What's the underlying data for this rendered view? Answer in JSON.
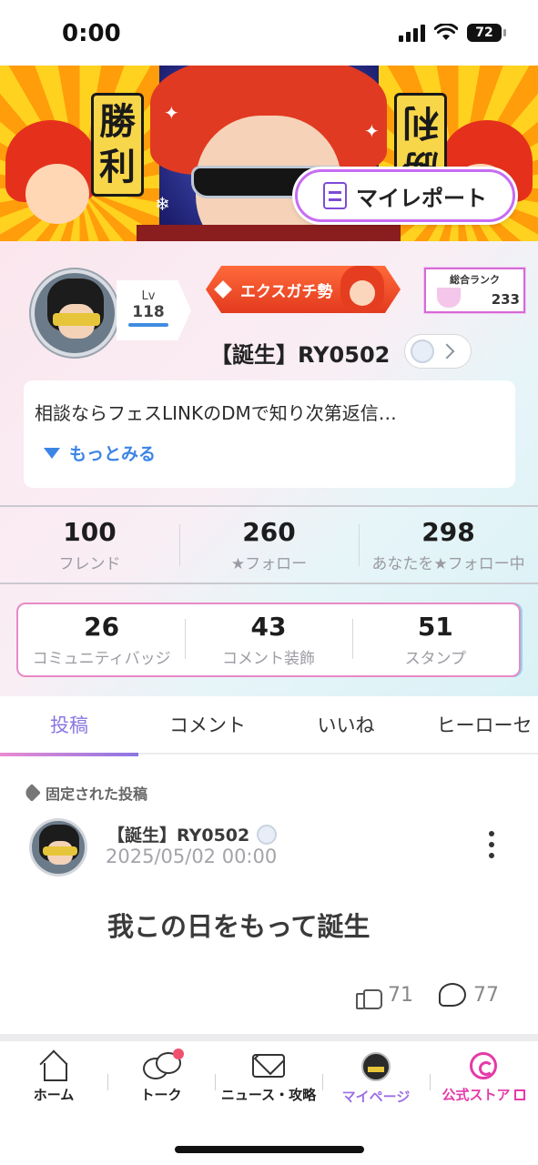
{
  "status_bar": {
    "time": "0:00",
    "battery": "72"
  },
  "banner": {
    "kanji_left": "勝利",
    "kanji_right": "勝利",
    "my_report_label": "マイレポート"
  },
  "profile": {
    "level_label": "Lv",
    "level_value": "118",
    "title_badge": "エクスガチ勢",
    "rank_label": "総合ランク",
    "rank_value": "233",
    "username": "【誕生】RY0502",
    "bio": "相談ならフェスLINKのDMで知り次第返信…",
    "see_more": "もっとみる"
  },
  "stats": [
    {
      "value": "100",
      "label": "フレンド"
    },
    {
      "value": "260",
      "label": "★フォロー"
    },
    {
      "value": "298",
      "label": "あなたを★フォロー中"
    }
  ],
  "collections": [
    {
      "value": "26",
      "label": "コミュニティバッジ"
    },
    {
      "value": "43",
      "label": "コメント装飾"
    },
    {
      "value": "51",
      "label": "スタンプ"
    }
  ],
  "tabs": [
    {
      "label": "投稿",
      "active": true
    },
    {
      "label": "コメント",
      "active": false
    },
    {
      "label": "いいね",
      "active": false
    },
    {
      "label": "ヒーローセ",
      "active": false
    }
  ],
  "post": {
    "pinned_label": "固定された投稿",
    "author": "【誕生】RY0502",
    "date": "2025/05/02 00:00",
    "body": "我この日をもって誕生",
    "likes": "71",
    "comments": "77"
  },
  "bottom_nav": [
    {
      "label": "ホーム",
      "icon": "home-icon"
    },
    {
      "label": "トーク",
      "icon": "talk-icon"
    },
    {
      "label": "ニュース・攻略",
      "icon": "news-icon"
    },
    {
      "label": "マイページ",
      "icon": "mypage-icon"
    },
    {
      "label": "公式ストア",
      "icon": "store-icon"
    }
  ],
  "colors": {
    "accent_purple": "#8b76e3",
    "link_blue": "#3c84e6",
    "store_pink": "#e53aa8",
    "badge_red": "#e23a1e"
  }
}
